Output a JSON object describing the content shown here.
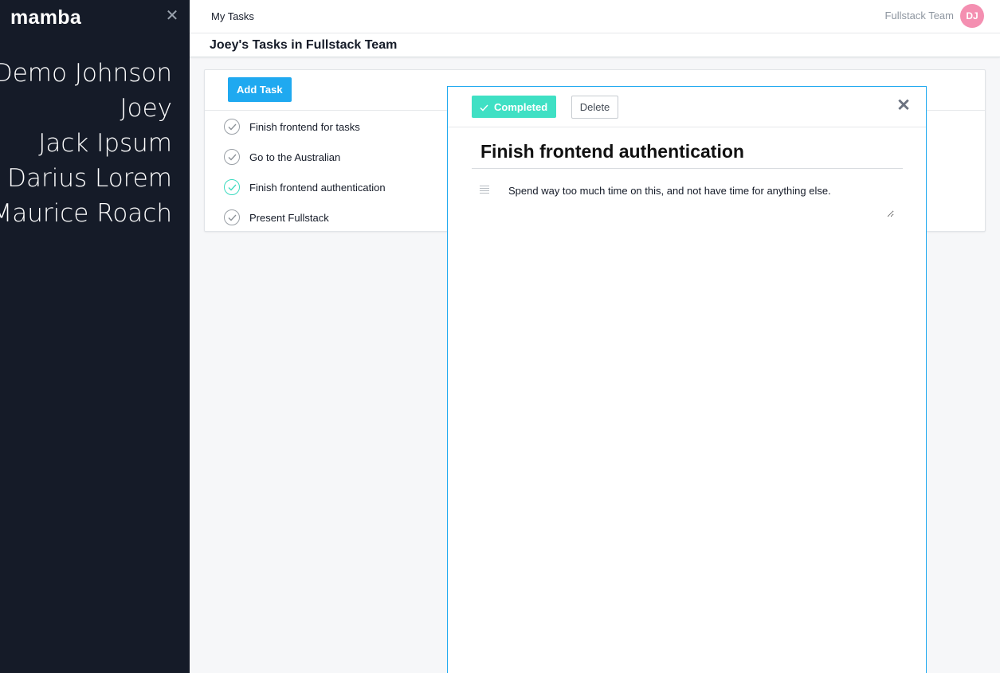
{
  "sidebar": {
    "brand": "mamba",
    "close_icon": "close-icon",
    "members": [
      "Demo Johnson",
      "Joey",
      "Jack Ipsum",
      "Darius Lorem",
      "Maurice Roach"
    ]
  },
  "header": {
    "title": "My Tasks",
    "team": "Fullstack Team",
    "avatar_initials": "DJ",
    "avatar_color": "#f48fb1"
  },
  "page": {
    "title": "Joey's Tasks in Fullstack Team"
  },
  "task_list": {
    "add_label": "Add Task",
    "tasks": [
      {
        "label": "Finish frontend for tasks",
        "completed": false
      },
      {
        "label": "Go to the Australian",
        "completed": false
      },
      {
        "label": "Finish frontend authentication",
        "completed": true
      },
      {
        "label": "Present Fullstack",
        "completed": false
      }
    ]
  },
  "detail": {
    "completed_label": "Completed",
    "delete_label": "Delete",
    "title": "Finish frontend authentication",
    "description": "Spend way too much time on this, and not have time for anything else."
  },
  "colors": {
    "sidebar_bg": "#151b28",
    "accent_blue": "#1fa9f0",
    "completed_teal": "#3fe0c4"
  }
}
